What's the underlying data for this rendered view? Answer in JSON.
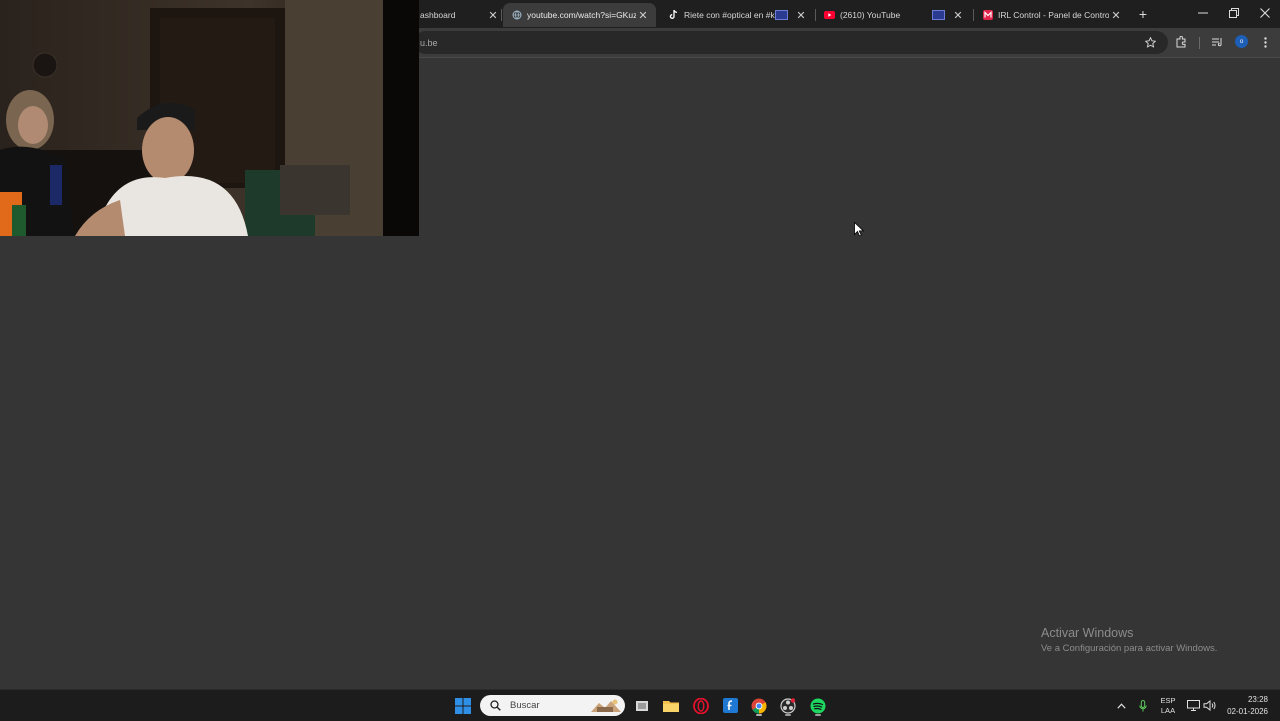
{
  "browser": {
    "tabs": [
      {
        "title": "ashboard",
        "icon": "none",
        "active": false
      },
      {
        "title": "youtube.com/watch?si=GKuzF\\",
        "icon": "globe-icon",
        "active": true
      },
      {
        "title": "Riete con #optical en #kick",
        "icon": "tiktok-icon",
        "active": false,
        "badge": true
      },
      {
        "title": "(2610) YouTube",
        "icon": "youtube-icon",
        "active": false,
        "badge": true
      },
      {
        "title": "IRL Control - Panel de Control",
        "icon": "irl-icon",
        "active": false
      }
    ],
    "url": "u.be",
    "profile_initial": "o"
  },
  "watermark": {
    "title": "Activar Windows",
    "subtitle": "Ve a Configuración para activar Windows."
  },
  "taskbar": {
    "search_placeholder": "Buscar",
    "language_top": "ESP",
    "language_bottom": "LAA",
    "time": "23:28",
    "date": "02-01-2026"
  },
  "colors": {
    "page_bg": "#353535",
    "youtube_red": "#ff0033",
    "windows_blue": "#2f8fe6",
    "spotify_green": "#1ed760"
  }
}
